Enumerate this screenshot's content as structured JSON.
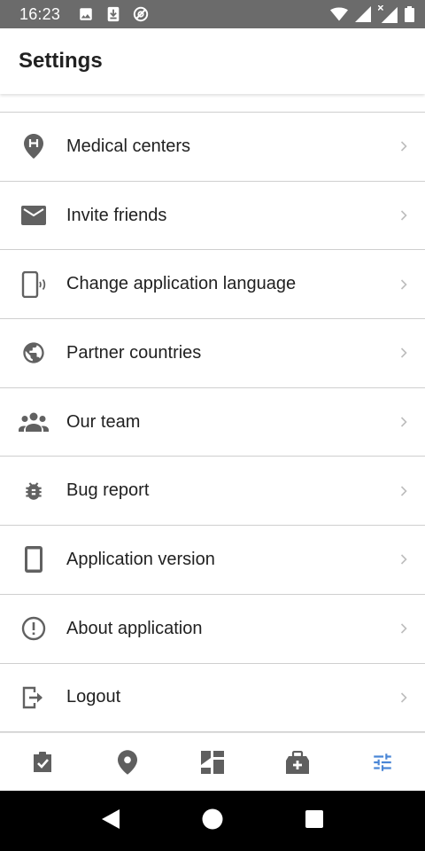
{
  "status_bar": {
    "time": "16:23",
    "icons": [
      "image-icon",
      "download-icon",
      "sync-off-icon",
      "wifi-icon",
      "signal-icon",
      "signal-no-data-icon",
      "battery-icon"
    ]
  },
  "app_bar": {
    "title": "Settings"
  },
  "settings": {
    "items": [
      {
        "label": "Medical centers",
        "icon": "hospital-pin-icon"
      },
      {
        "label": "Invite friends",
        "icon": "mail-icon"
      },
      {
        "label": "Change application language",
        "icon": "phone-sound-icon"
      },
      {
        "label": "Partner countries",
        "icon": "globe-icon"
      },
      {
        "label": "Our team",
        "icon": "group-icon"
      },
      {
        "label": "Bug report",
        "icon": "bug-icon"
      },
      {
        "label": "Application version",
        "icon": "smartphone-icon"
      },
      {
        "label": "About application",
        "icon": "info-circle-icon"
      },
      {
        "label": "Logout",
        "icon": "logout-icon"
      }
    ]
  },
  "bottom_nav": {
    "active_color": "#4a86d6",
    "inactive_color": "#5f5f5f",
    "items": [
      {
        "icon": "checkbox-clipboard-icon",
        "active": false
      },
      {
        "icon": "map-pin-icon",
        "active": false
      },
      {
        "icon": "dashboard-icon",
        "active": false
      },
      {
        "icon": "medical-kit-icon",
        "active": false
      },
      {
        "icon": "tune-sliders-icon",
        "active": true
      }
    ]
  },
  "colors": {
    "status_bar": "#6b6b6b",
    "icon_gray": "#616161",
    "chevron": "#bdbdbd",
    "divider": "#cfcfcf"
  }
}
